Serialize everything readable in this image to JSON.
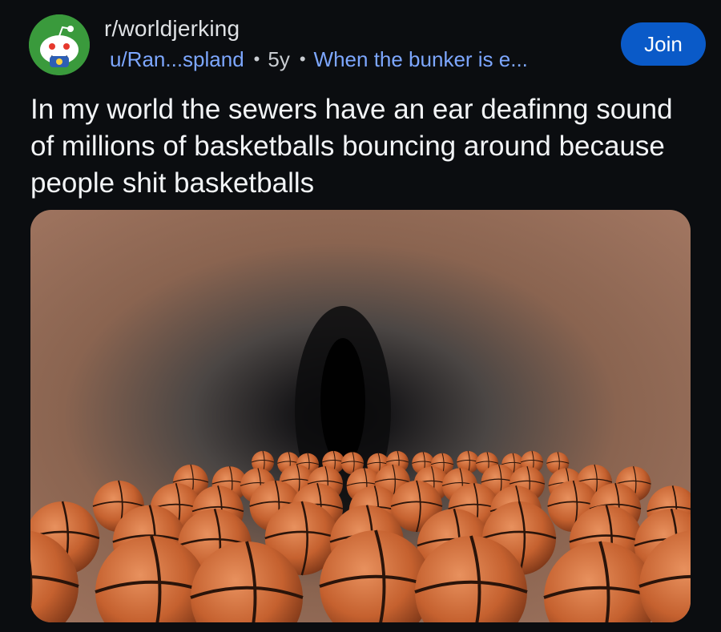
{
  "post": {
    "subreddit": "r/worldjerking",
    "author": "u/Ran...spland",
    "age": "5y",
    "flair": "When the bunker is e...",
    "join_label": "Join",
    "title": "In my world the sewers have an ear deafinng sound of millions of basketballs bouncing around because people shit basketballs"
  },
  "colors": {
    "accent": "#0a5ac8",
    "link": "#7da7ff",
    "avatar_bg": "#3a9a3c",
    "background": "#0b0d10"
  },
  "icons": {
    "avatar": "subreddit-avatar-icon"
  }
}
